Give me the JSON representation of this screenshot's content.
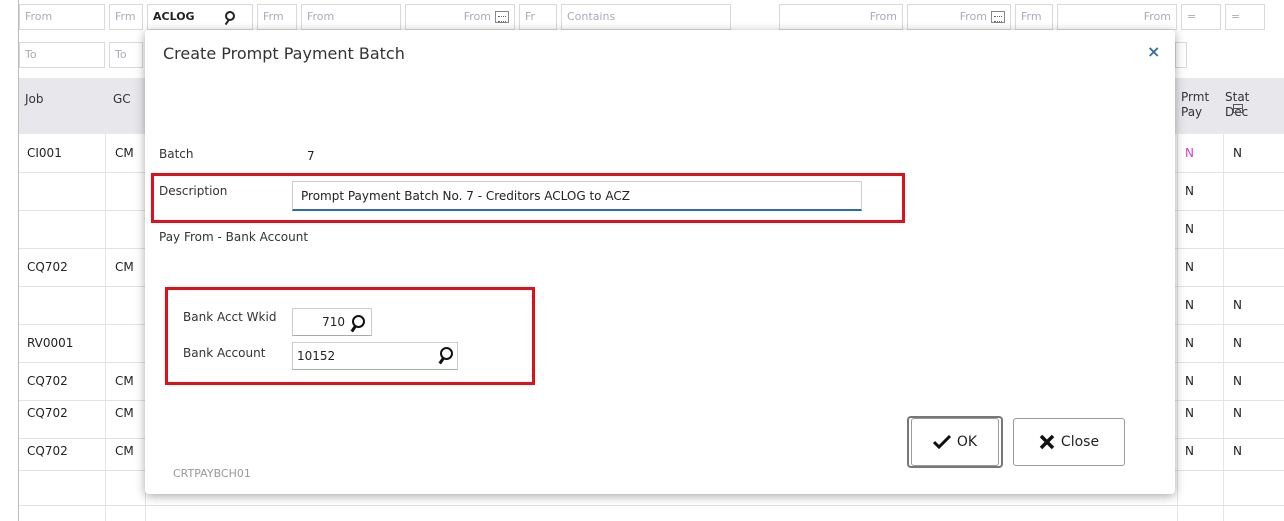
{
  "filters": {
    "row1": [
      "From",
      "Frm",
      "ACLOG",
      "Frm",
      "From",
      "From",
      "Fr",
      "Contains",
      "From",
      "From",
      "Frm",
      "From",
      "=",
      "="
    ],
    "row2": [
      "To",
      "To"
    ]
  },
  "grid": {
    "headers": {
      "job": "Job",
      "gc": "GC",
      "prmt_pay": "Prmt\nPay",
      "stat_dec": "Stat\nDec"
    },
    "rows": [
      {
        "job": "CI001",
        "gc": "CM",
        "prmt": "N",
        "stat": "N"
      },
      {
        "job": "",
        "gc": "",
        "prmt": "N",
        "stat": ""
      },
      {
        "job": "",
        "gc": "",
        "prmt": "N",
        "stat": ""
      },
      {
        "job": "CQ702",
        "gc": "CM",
        "prmt": "N",
        "stat": ""
      },
      {
        "job": "",
        "gc": "",
        "prmt": "N",
        "stat": "N"
      },
      {
        "job": "RV0001",
        "gc": "",
        "prmt": "N",
        "stat": "N"
      },
      {
        "job": "CQ702",
        "gc": "CM",
        "prmt": "N",
        "stat": "N"
      },
      {
        "job": "CQ702",
        "gc": "CM",
        "prmt": "N",
        "stat": "N"
      },
      {
        "job": "CQ702",
        "gc": "CM",
        "prmt": "N",
        "stat": "N"
      }
    ]
  },
  "dialog": {
    "title": "Create Prompt Payment Batch",
    "close_glyph": "×",
    "batch_label": "Batch",
    "batch_value": "7",
    "description_label": "Description",
    "description_value": "Prompt Payment Batch No. 7 - Creditors ACLOG to ACZ",
    "pay_from_label": "Pay From - Bank Account",
    "bank_wkid_label": "Bank Acct Wkid",
    "bank_wkid_value": "710",
    "bank_account_label": "Bank Account",
    "bank_account_value": "10152",
    "ok_label": "OK",
    "close_label": "Close",
    "form_code": "CRTPAYBCH01"
  },
  "colors": {
    "highlight": "#e0101a",
    "accent": "#2b6cb0",
    "pink": "#d63fc8"
  },
  "icons": [
    "search-icon",
    "calendar-icon",
    "close-icon",
    "checkmark-icon",
    "x-icon",
    "column-chooser-icon"
  ]
}
